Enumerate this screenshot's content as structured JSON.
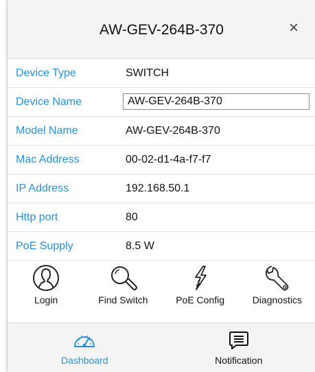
{
  "dialog": {
    "title": "AW-GEV-264B-370",
    "close_icon": "close-icon"
  },
  "info": {
    "device_type": {
      "label": "Device Type",
      "value": "SWITCH"
    },
    "device_name": {
      "label": "Device Name",
      "value": "AW-GEV-264B-370"
    },
    "model_name": {
      "label": "Model Name",
      "value": "AW-GEV-264B-370"
    },
    "mac_address": {
      "label": "Mac Address",
      "value": "00-02-d1-4a-f7-f7"
    },
    "ip_address": {
      "label": "IP Address",
      "value": "192.168.50.1"
    },
    "http_port": {
      "label": "Http port",
      "value": "80"
    },
    "poe_supply": {
      "label": "PoE Supply",
      "value": "8.5 W"
    }
  },
  "actions": {
    "login": {
      "label": "Login",
      "icon": "user-icon"
    },
    "find_switch": {
      "label": "Find Switch",
      "icon": "magnifier-icon"
    },
    "poe_config": {
      "label": "PoE Config",
      "icon": "lightning-icon"
    },
    "diagnostics": {
      "label": "Diagnostics",
      "icon": "wrench-icon"
    }
  },
  "tabs": {
    "dashboard": {
      "label": "Dashboard",
      "icon": "speedometer-icon",
      "active": true
    },
    "notification": {
      "label": "Notification",
      "icon": "message-icon",
      "active": false
    }
  },
  "colors": {
    "label_blue": "#2a8fd6",
    "header_bg": "#f4f4f4",
    "text": "#111111"
  }
}
